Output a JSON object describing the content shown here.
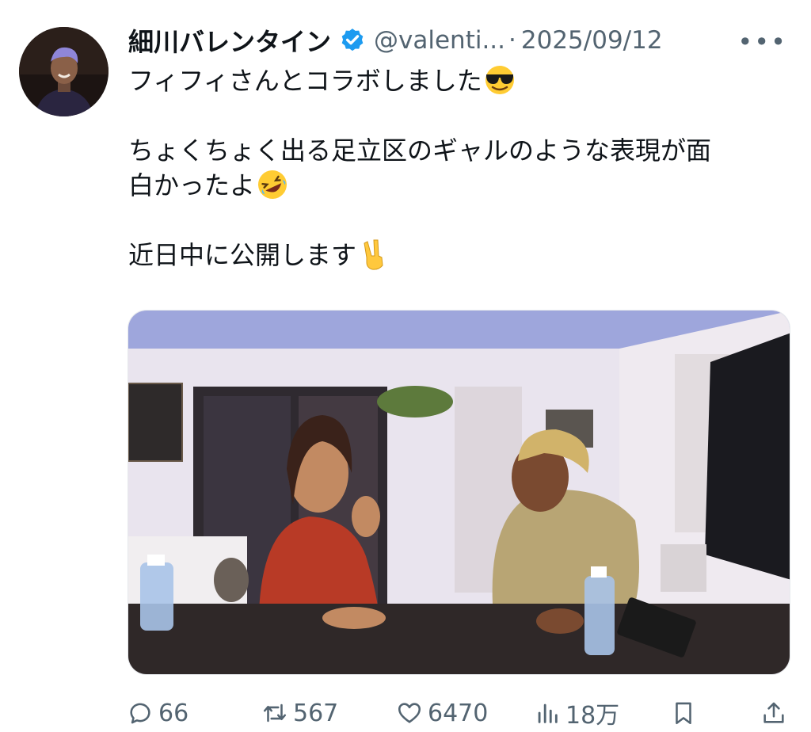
{
  "tweet": {
    "author_name": "細川バレンタイン",
    "handle": "@valenti...",
    "separator": "·",
    "date": "2025/09/12",
    "more_label": "•••",
    "body": {
      "line1": "フィフィさんとコラボしました",
      "line2": "ちょくちょく出る足立区のギャルのような表現が面",
      "line3": "白かったよ",
      "line4": "近日中に公開します"
    },
    "emojis": [
      "smiling-face-with-sunglasses",
      "rolling-on-the-floor-laughing",
      "victory-hand"
    ],
    "media_description_icon": "photo"
  },
  "actions": {
    "replies": "66",
    "retweets": "567",
    "likes": "6470",
    "views": "18万"
  },
  "colors": {
    "text_primary": "#0f1419",
    "text_secondary": "#536471",
    "verified_blue": "#1d9bf0"
  }
}
